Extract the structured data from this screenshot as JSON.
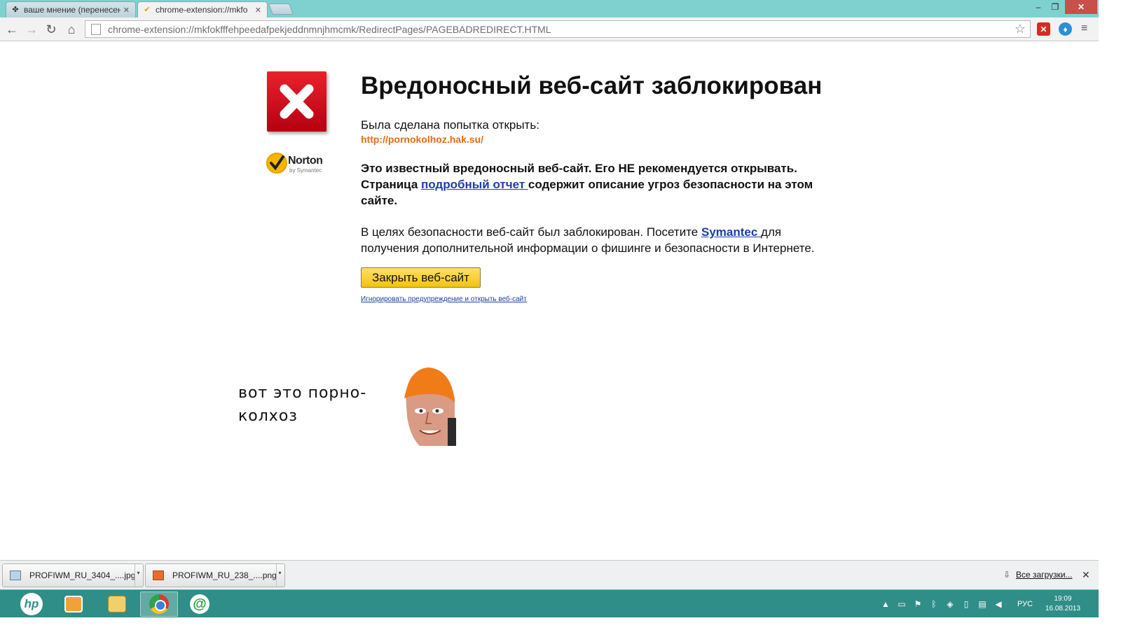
{
  "tabs": [
    {
      "label": "ваше мнение (перенесен",
      "active": false
    },
    {
      "label": "chrome-extension://mkfo",
      "active": true
    }
  ],
  "window_controls": {
    "minimize": "–",
    "maximize": "❐",
    "close": "✕"
  },
  "address_bar": {
    "url": "chrome-extension://mkfokfffehpeedafpekjeddnmnjhmcmk/RedirectPages/PAGEBADREDIRECT.HTML"
  },
  "page": {
    "title": "Вредоносный веб-сайт заблокирован",
    "norton_brand": "Norton",
    "norton_by": "by Symantec",
    "attempt_label": "Была сделана попытка открыть:",
    "blocked_url": "http://pornokolhoz.hak.su/",
    "warning_part1": "Это известный вредоносный веб-сайт. Его НЕ рекомендуется открывать. Страница ",
    "warning_link": "подробный отчет ",
    "warning_part2": "содержит описание угроз безопасности на этом сайте.",
    "info_part1": "В целях безопасности веб-сайт был заблокирован. Посетите ",
    "info_link": "Symantec ",
    "info_part2": "для получения дополнительной информации о фишинге и безопасности в Интернете.",
    "close_button": "Закрыть веб-сайт",
    "ignore_link": "Игнорировать предупреждение и открыть веб-сайт",
    "meme_line1": "вот это порно-",
    "meme_line2": "колхоз"
  },
  "downloads": {
    "items": [
      {
        "name": "PROFIWM_RU_3404_....jpg"
      },
      {
        "name": "PROFIWM_RU_238_....png"
      }
    ],
    "all_downloads": "Все загрузки..."
  },
  "taskbar": {
    "language": "РУС",
    "time": "19:09",
    "date": "16.08.2013"
  },
  "colors": {
    "titlebar": "#7fd1cf",
    "taskbar": "#2f8e87",
    "bad_url": "#e96b10",
    "link": "#1a3fa8",
    "button": "#f4c20d"
  }
}
